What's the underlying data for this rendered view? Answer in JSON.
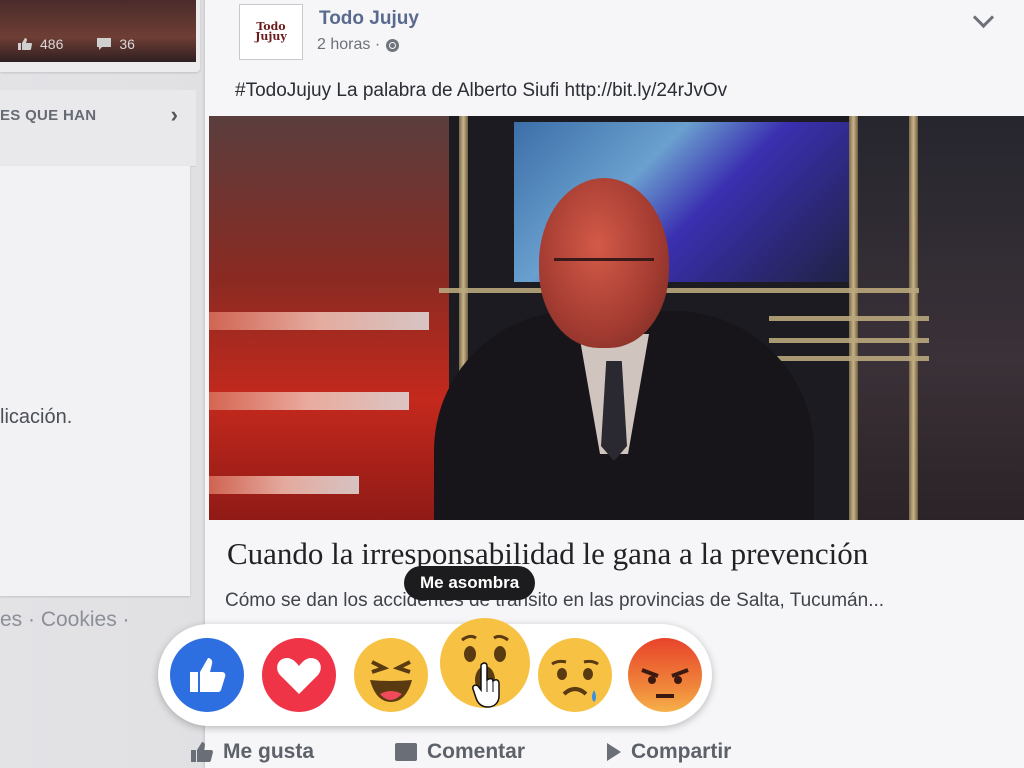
{
  "left_column": {
    "top_card": {
      "like_count": "486",
      "comment_count": "36"
    },
    "section_header": {
      "title": "ES QUE HAN",
      "arrow": "›"
    },
    "body_text": "licación.",
    "footer_links": "es · Cookies ·"
  },
  "post": {
    "page_logo_text": "Todo Jujuy",
    "page_name": "Todo Jujuy",
    "timestamp": "2 horas · ",
    "text": "#TodoJujuy La palabra de Alberto Siufi http://bit.ly/24rJvOv",
    "link": {
      "title": "Cuando la irresponsabilidad le gana a la prevención",
      "description": "Cómo se dan los accidentes de tránsito en las provincias de Salta, Tucumán..."
    },
    "actions": {
      "like_label": "Me gusta",
      "comment_label": "Comentar",
      "share_label": "Compartir"
    }
  },
  "reactions": {
    "tooltip": "Me asombra",
    "items": [
      "like",
      "love",
      "haha",
      "wow",
      "sad",
      "angry"
    ],
    "hovered": "wow"
  },
  "colors": {
    "like": "#2d6fe0",
    "love": "#f03447",
    "emoji_yellow": "#f7c244",
    "angry_top": "#e8432a",
    "page_name": "#5a6a8f"
  },
  "icons": [
    "like-icon",
    "comment-icon",
    "globe-icon",
    "chevron-down-icon",
    "share-icon",
    "hand-cursor-icon"
  ]
}
